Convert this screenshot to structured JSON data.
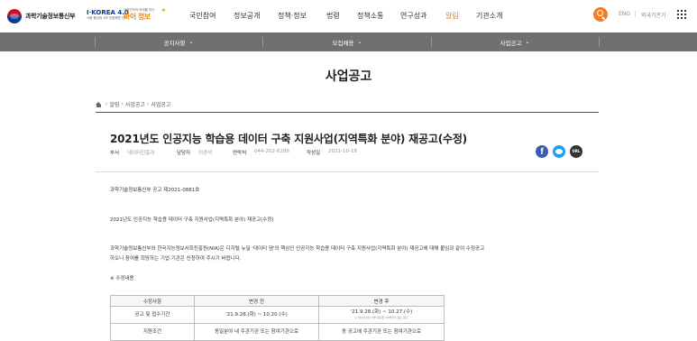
{
  "header": {
    "ministry_name": "과학기술정보통신부",
    "ikorea_logo": "I·KOREA 4.0",
    "ikorea_sub": "사람 중심의 4차 산업혁명 선도",
    "slogan_small": "대한민국의 미래를 여는",
    "slogan_big": "바이 정보",
    "gnb": [
      "국민참여",
      "정보공개",
      "정책·정보",
      "법령",
      "정책소통",
      "연구성과",
      "알림",
      "기관소개"
    ],
    "active_gnb": "알림",
    "eng_label": "ENG",
    "intl_label": "외국기관기"
  },
  "subnav": {
    "items": [
      {
        "label": "공지사항"
      },
      {
        "label": "모집채용"
      },
      {
        "label": "사업공고"
      }
    ]
  },
  "page": {
    "title": "사업공고",
    "breadcrumb": [
      "알림",
      "사업공고",
      "사업공고"
    ]
  },
  "post": {
    "title": "2021년도 인공지능 학습용 데이터 구축 지원사업(지역특화 분야) 재공고(수정)",
    "meta": {
      "dept_label": "부서",
      "dept_value": "데이터진흥과",
      "manager_label": "담당자",
      "manager_value": "이경석",
      "contact_label": "연락처",
      "contact_value": "044-202-6286",
      "date_label": "작성일",
      "date_value": "2021-10-18"
    },
    "share": {
      "facebook": "f",
      "url": "URL"
    },
    "notice_no": "과학기술정보통신부 공고 제2021-0881호",
    "notice_title": "2021년도 인공지능 학습용 데이터 구축 지원사업(지역특화 분야) 재공고(수정)",
    "paragraph_line1": "과학기술정보통신부와 한국지능정보사회진흥원(NIA)은 디지털 뉴딜 '데이터 댐'의 핵심인 인공지능 학습용 데이터 구축 지원사업(지역특화 분야) 재공고에 대해 붙임과 같이 수정공고",
    "paragraph_line2": "하오니 참여를 희망하는 기업·기관은 신청하여 주시기 바랍니다.",
    "edit_heading": "※ 수정내용"
  },
  "table": {
    "headers": [
      "수정사항",
      "변경 전",
      "변경 후"
    ],
    "rows": [
      {
        "item": "공고 및 접수기간",
        "before": "'21.9.28.(화) ~ 10.20.(수)",
        "after": "'21.9.28.(화) ~ 10.27.(수)",
        "after_note": "※ 접수마감은 세부 일정은 20페이지 참조 참조"
      },
      {
        "item": "지원조건",
        "before": "동일분야 내  주관기관 또는 참여기관으로",
        "after": "동 공고에 주관기관 또는 참여기관으로"
      }
    ]
  },
  "colors": {
    "accent": "#f57c22",
    "subnav_bg": "#707070",
    "facebook": "#3b5bb5",
    "twitter": "#1da1f2"
  }
}
